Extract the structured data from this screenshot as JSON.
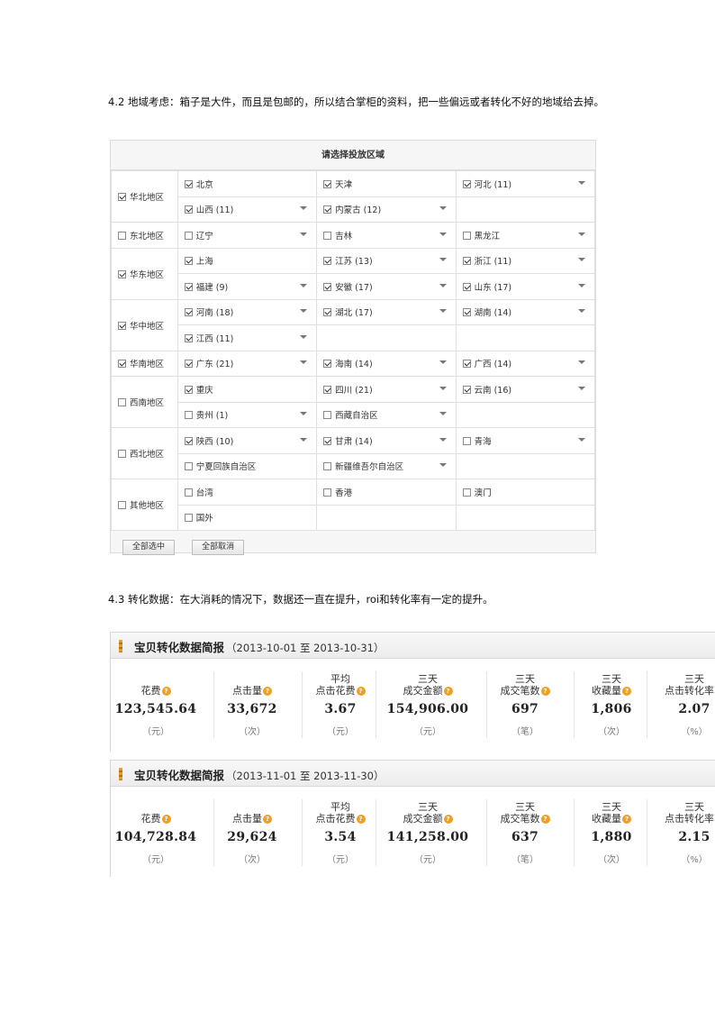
{
  "paragraph1": "4.2 地域考虑：箱子是大件，而且是包邮的，所以结合掌柜的资料，把一些偏远或者转化不好的地域给去掉。",
  "region_panel": {
    "title": "请选择投放区域",
    "rows": [
      {
        "region": "华北地区",
        "checked": true,
        "lines": [
          [
            {
              "name": "北京",
              "checked": true,
              "dropdown": false
            },
            {
              "name": "天津",
              "checked": true,
              "dropdown": false
            },
            {
              "name": "河北 (11)",
              "checked": true,
              "dropdown": true
            }
          ],
          [
            {
              "name": "山西 (11)",
              "checked": true,
              "dropdown": true
            },
            {
              "name": "内蒙古 (12)",
              "checked": true,
              "dropdown": true
            }
          ]
        ]
      },
      {
        "region": "东北地区",
        "checked": false,
        "lines": [
          [
            {
              "name": "辽宁",
              "checked": false,
              "dropdown": true
            },
            {
              "name": "吉林",
              "checked": false,
              "dropdown": true
            },
            {
              "name": "黑龙江",
              "checked": false,
              "dropdown": true
            }
          ]
        ]
      },
      {
        "region": "华东地区",
        "checked": true,
        "lines": [
          [
            {
              "name": "上海",
              "checked": true,
              "dropdown": false
            },
            {
              "name": "江苏 (13)",
              "checked": true,
              "dropdown": true
            },
            {
              "name": "浙江 (11)",
              "checked": true,
              "dropdown": true
            }
          ],
          [
            {
              "name": "福建 (9)",
              "checked": true,
              "dropdown": true
            },
            {
              "name": "安徽 (17)",
              "checked": true,
              "dropdown": true
            },
            {
              "name": "山东 (17)",
              "checked": true,
              "dropdown": true
            }
          ]
        ]
      },
      {
        "region": "华中地区",
        "checked": true,
        "lines": [
          [
            {
              "name": "河南 (18)",
              "checked": true,
              "dropdown": true
            },
            {
              "name": "湖北 (17)",
              "checked": true,
              "dropdown": true
            },
            {
              "name": "湖南 (14)",
              "checked": true,
              "dropdown": true
            }
          ],
          [
            {
              "name": "江西 (11)",
              "checked": true,
              "dropdown": true
            }
          ]
        ]
      },
      {
        "region": "华南地区",
        "checked": true,
        "lines": [
          [
            {
              "name": "广东 (21)",
              "checked": true,
              "dropdown": true
            },
            {
              "name": "海南 (14)",
              "checked": true,
              "dropdown": true
            },
            {
              "name": "广西 (14)",
              "checked": true,
              "dropdown": true
            }
          ]
        ]
      },
      {
        "region": "西南地区",
        "checked": false,
        "lines": [
          [
            {
              "name": "重庆",
              "checked": true,
              "dropdown": false
            },
            {
              "name": "四川 (21)",
              "checked": true,
              "dropdown": true
            },
            {
              "name": "云南 (16)",
              "checked": true,
              "dropdown": true
            }
          ],
          [
            {
              "name": "贵州 (1)",
              "checked": false,
              "dropdown": true
            },
            {
              "name": "西藏自治区",
              "checked": false,
              "dropdown": true
            }
          ]
        ]
      },
      {
        "region": "西北地区",
        "checked": false,
        "lines": [
          [
            {
              "name": "陕西 (10)",
              "checked": true,
              "dropdown": true
            },
            {
              "name": "甘肃 (14)",
              "checked": true,
              "dropdown": true
            },
            {
              "name": "青海",
              "checked": false,
              "dropdown": true
            }
          ],
          [
            {
              "name": "宁夏回族自治区",
              "checked": false,
              "dropdown": false
            },
            {
              "name": "新疆维吾尔自治区",
              "checked": false,
              "dropdown": true
            }
          ]
        ]
      },
      {
        "region": "其他地区",
        "checked": false,
        "lines": [
          [
            {
              "name": "台湾",
              "checked": false,
              "dropdown": false
            },
            {
              "name": "香港",
              "checked": false,
              "dropdown": false
            },
            {
              "name": "澳门",
              "checked": false,
              "dropdown": false
            }
          ],
          [
            {
              "name": "国外",
              "checked": false,
              "dropdown": false
            }
          ]
        ]
      }
    ],
    "buttons": {
      "select_all": "全部选中",
      "cancel_all": "全部取消"
    }
  },
  "paragraph2": "4.3 转化数据：在大消耗的情况下，数据还一直在提升，roi和转化率有一定的提升。",
  "reports": [
    {
      "title": "宝贝转化数据简报",
      "range": "（2013-10-01 至 2013-10-31）",
      "metrics": [
        {
          "line1": "",
          "line2": "花费",
          "value": "123,545.64",
          "unit": "（元）"
        },
        {
          "line1": "",
          "line2": "点击量",
          "value": "33,672",
          "unit": "（次）"
        },
        {
          "line1": "平均",
          "line2": "点击花费",
          "value": "3.67",
          "unit": "（元）"
        },
        {
          "line1": "三天",
          "line2": "成交金额",
          "value": "154,906.00",
          "unit": "（元）"
        },
        {
          "line1": "三天",
          "line2": "成交笔数",
          "value": "697",
          "unit": "（笔）"
        },
        {
          "line1": "三天",
          "line2": "收藏量",
          "value": "1,806",
          "unit": "（次）"
        },
        {
          "line1": "三天",
          "line2": "点击转化率",
          "value": "2.07",
          "unit": "（%）"
        }
      ]
    },
    {
      "title": "宝贝转化数据简报",
      "range": "（2013-11-01 至 2013-11-30）",
      "metrics": [
        {
          "line1": "",
          "line2": "花费",
          "value": "104,728.84",
          "unit": "（元）"
        },
        {
          "line1": "",
          "line2": "点击量",
          "value": "29,624",
          "unit": "（次）"
        },
        {
          "line1": "平均",
          "line2": "点击花费",
          "value": "3.54",
          "unit": "（元）"
        },
        {
          "line1": "三天",
          "line2": "成交金额",
          "value": "141,258.00",
          "unit": "（元）"
        },
        {
          "line1": "三天",
          "line2": "成交笔数",
          "value": "637",
          "unit": "（笔）"
        },
        {
          "line1": "三天",
          "line2": "收藏量",
          "value": "1,880",
          "unit": "（次）"
        },
        {
          "line1": "三天",
          "line2": "点击转化率",
          "value": "2.15",
          "unit": "（%）"
        }
      ]
    }
  ],
  "help_icon_glyph": "?",
  "colors": {
    "help_icon": "#f0a020",
    "panel_bg": "#f6f6f6"
  }
}
